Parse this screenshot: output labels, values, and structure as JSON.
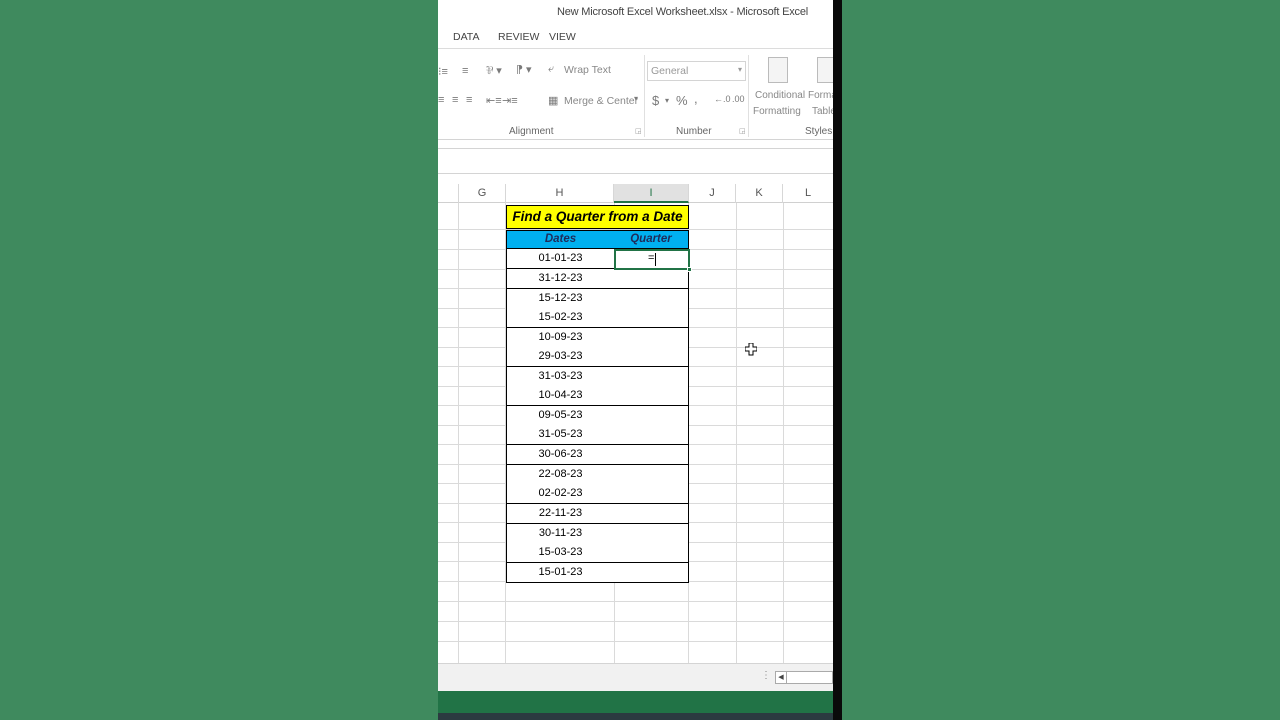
{
  "window": {
    "title": "New Microsoft Excel Worksheet.xlsx - Microsoft Excel"
  },
  "tabs": [
    "DATA",
    "REVIEW",
    "VIEW"
  ],
  "ribbon": {
    "wrap_text": "Wrap Text",
    "merge_center": "Merge & Center",
    "number_format_value": "General",
    "currency_symbol": "$",
    "percent_symbol": "%",
    "comma_symbol": ",",
    "conditional_line1": "Conditional",
    "conditional_line2": "Formatting",
    "format_table_line1": "Forma",
    "format_table_line2": "Table",
    "groups": {
      "alignment": "Alignment",
      "number": "Number",
      "styles": "Styles"
    }
  },
  "columns": [
    "G",
    "H",
    "I",
    "J",
    "K",
    "L"
  ],
  "active_column": "I",
  "table": {
    "title": "Find a Quarter from a Date",
    "headers": {
      "dates": "Dates",
      "quarter": "Quarter"
    },
    "dates": [
      "01-01-23",
      "31-12-23",
      "15-12-23",
      "15-02-23",
      "10-09-23",
      "29-03-23",
      "31-03-23",
      "10-04-23",
      "09-05-23",
      "31-05-23",
      "30-06-23",
      "22-08-23",
      "02-02-23",
      "22-11-23",
      "30-11-23",
      "15-03-23",
      "15-01-23"
    ],
    "active_cell_input": "="
  },
  "colors": {
    "excel_green": "#217346",
    "title_fill": "#ffff00",
    "header_fill": "#00b0f0",
    "background": "#3f8a5e"
  }
}
